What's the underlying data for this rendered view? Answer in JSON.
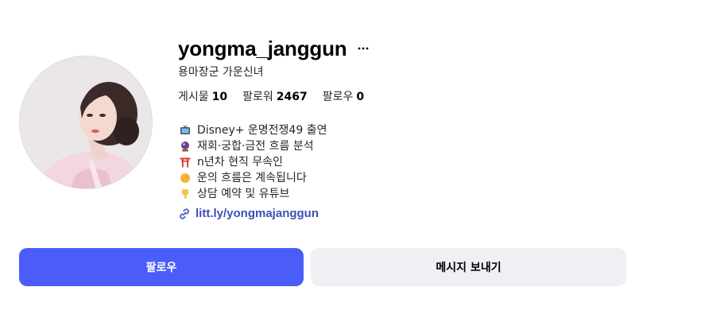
{
  "profile": {
    "username": "yongma_janggun",
    "full_name": "용마장군 가운신녀",
    "avatar_alt": "profile-photo"
  },
  "stats": {
    "posts_label": "게시물",
    "posts_count": "10",
    "followers_label": "팔로워",
    "followers_count": "2467",
    "following_label": "팔로우",
    "following_count": "0"
  },
  "bio": {
    "lines": [
      {
        "icon": "tv-icon",
        "text": "Disney+ 운명전쟁49 출연"
      },
      {
        "icon": "crystal-ball-icon",
        "text": "재회·궁합·금전 흐름 분석"
      },
      {
        "icon": "torii-gate-icon",
        "text": "n년차 현직 무속인"
      },
      {
        "icon": "moon-icon",
        "text": "운의 흐름은 계속됩니다"
      },
      {
        "icon": "pointing-down-icon",
        "text": "상담 예약 및 유튜브"
      }
    ],
    "link": "litt.ly/yongmajanggun",
    "link_color": "#3d4fb8"
  },
  "actions": {
    "follow_label": "팔로우",
    "message_label": "메시지 보내기",
    "follow_color": "#4a5df9",
    "message_color": "#eff0f4"
  }
}
